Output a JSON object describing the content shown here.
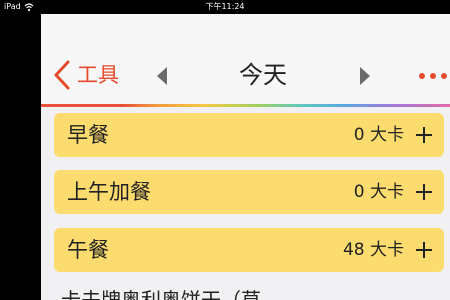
{
  "status_bar": {
    "device": "iPad",
    "time": "下午11:24",
    "wifi_icon": "wifi-icon"
  },
  "nav": {
    "back_label": "工具",
    "title": "今天",
    "accent_color": "#e54a2a"
  },
  "meals": [
    {
      "name": "早餐",
      "calories": "0 大卡"
    },
    {
      "name": "上午加餐",
      "calories": "0 大卡"
    },
    {
      "name": "午餐",
      "calories": "48 大卡"
    }
  ],
  "food_items": [
    {
      "name": "卡夫牌奥利奥饼干（草"
    }
  ],
  "colors": {
    "meal_row": "#fcdc6e",
    "background": "#f1f1f3"
  }
}
